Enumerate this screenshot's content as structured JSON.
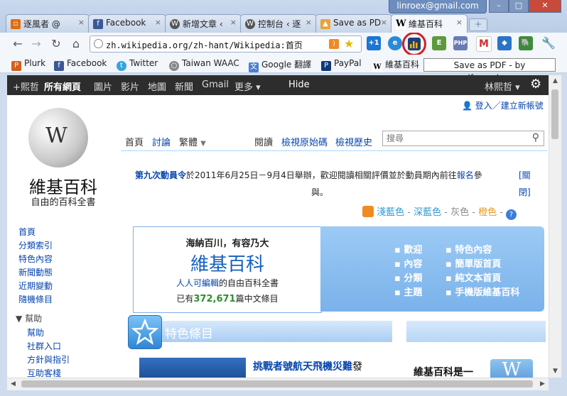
{
  "window": {
    "user_email": "linroex@gmail.com",
    "tabs": [
      {
        "label": "逐風者 @",
        "icon": "blog-icon"
      },
      {
        "label": "Facebook",
        "icon": "facebook-icon"
      },
      {
        "label": "新增文章 ‹",
        "icon": "wordpress-icon"
      },
      {
        "label": "控制台 ‹ 逐",
        "icon": "wordpress-icon"
      },
      {
        "label": "Save as PD",
        "icon": "pdfcrowd-icon"
      },
      {
        "label": "維基百科",
        "icon": "wikipedia-icon"
      }
    ]
  },
  "toolbar": {
    "url": "zh.wikipedia.org/zh-hant/Wikipedia:首页",
    "tooltip": "Save as PDF - by pdfcrowd.com",
    "extensions": [
      "plus1-extension-icon",
      "internet-explorer-icon",
      "pdfcrowd-icon",
      "evernote-clip-icon",
      "php-icon",
      "gmail-icon",
      "dropbox-icon",
      "evernote-icon",
      "wrench-icon"
    ]
  },
  "bookmarks": [
    {
      "label": "Plurk",
      "icon": "plurk-icon"
    },
    {
      "label": "Facebook",
      "icon": "facebook-icon"
    },
    {
      "label": "Twitter",
      "icon": "twitter-icon"
    },
    {
      "label": "Taiwan WAAC",
      "icon": "globe-icon"
    },
    {
      "label": "Google 翻譯",
      "icon": "google-translate-icon"
    },
    {
      "label": "PayPal",
      "icon": "paypal-icon"
    },
    {
      "label": "維基百科",
      "icon": "wikipedia-icon"
    }
  ],
  "gbar": {
    "items": [
      "+熙哲",
      "所有網頁",
      "圖片",
      "影片",
      "地圖",
      "新聞",
      "Gmail",
      "更多 ▾"
    ],
    "hide": "Hide",
    "user": "林熙哲 ▾"
  },
  "wiki": {
    "login": "登入／建立新帳號",
    "logo_title": "維基百科",
    "logo_subtitle": "自由的百科全書",
    "tabs": [
      "首頁",
      "討論",
      "繁體",
      "閱讀",
      "檢視原始碼",
      "檢視歷史"
    ],
    "search_placeholder": "搜尋",
    "notice_bold": "第九次動員令",
    "notice_text": "於2011年6月25日－9月4日舉辦，歡迎閱讀相關評價並於動員期內前往",
    "notice_link": "報名",
    "notice_end": "參",
    "notice_line2": "與。",
    "notice_close": "[關",
    "notice_close2": "閉]",
    "skins": [
      "淺藍色",
      "深藍色",
      "灰色",
      "橙色"
    ],
    "sidebar": [
      "首頁",
      "分類索引",
      "特色內容",
      "新聞動態",
      "近期變動",
      "隨機條目"
    ],
    "help_heading": "幫助",
    "help_items": [
      "幫助",
      "社群入口",
      "方針與指引",
      "互助客棧"
    ],
    "portal_tagline": "海納百川，有容乃大",
    "portal_title": "維基百科",
    "portal_desc_a": "人人可編輯",
    "portal_desc_b": "的自由百科全書",
    "portal_count_a": "已有",
    "portal_count": "372,671",
    "portal_count_b": "篇中文條目",
    "portal_links_left": [
      "歡迎",
      "內容",
      "分類",
      "主題"
    ],
    "portal_links_right": [
      "特色內容",
      "簡單版首頁",
      "純文本首頁",
      "手機版維基百科"
    ],
    "featured_title": "特色條目",
    "featured_article": "挑戰者號航天飛機災難",
    "featured_suffix": "發",
    "right_box_text": "維基百科是一"
  }
}
